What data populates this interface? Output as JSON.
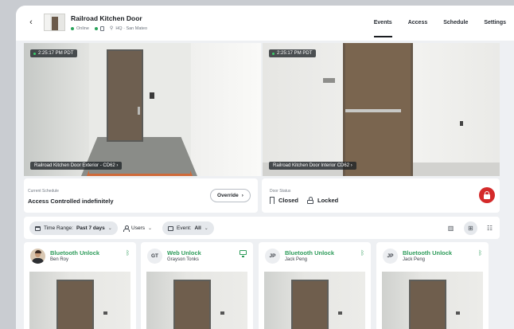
{
  "header": {
    "back_icon": "back-chevron-icon",
    "title": "Railroad Kitchen Door",
    "status": "Online",
    "status_color": "#29a35a",
    "location": "HQ · San Mateo",
    "tabs": [
      {
        "label": "Events",
        "active": true
      },
      {
        "label": "Access",
        "active": false
      },
      {
        "label": "Schedule",
        "active": false
      },
      {
        "label": "Settings",
        "active": false
      }
    ]
  },
  "cameras": [
    {
      "timestamp": "2:25:17 PM PDT",
      "label": "Railroad Kitchen Door Exterior - CD62 ›"
    },
    {
      "timestamp": "2:25:17 PM PDT",
      "label": "Railroad Kitchen Door Interior CD62 ›"
    }
  ],
  "schedule": {
    "label": "Current Schedule",
    "value": "Access Controlled indefinitely",
    "override_label": "Override"
  },
  "door_status": {
    "label": "Door Status",
    "closed": "Closed",
    "locked": "Locked",
    "lock_button_color": "#d42a2a"
  },
  "filters": {
    "time_range_label": "Time Range:",
    "time_range_value": "Past 7 days",
    "users_label": "Users",
    "event_label": "Event:",
    "event_value": "All",
    "views": [
      "bar-chart-icon",
      "grid-icon",
      "list-icon"
    ],
    "active_view": "grid-icon"
  },
  "events": [
    {
      "title": "Bluetooth Unlock",
      "user": "Ben Roy",
      "initials": "",
      "type": "bluetooth",
      "accent": "#2f9c5b"
    },
    {
      "title": "Web Unlock",
      "user": "Grayson Tonks",
      "initials": "GT",
      "type": "web"
    },
    {
      "title": "Bluetooth Unlock",
      "user": "Jack Peng",
      "initials": "JP",
      "type": "bluetooth"
    },
    {
      "title": "Bluetooth Unlock",
      "user": "Jack Peng",
      "initials": "JP",
      "type": "bluetooth"
    }
  ]
}
